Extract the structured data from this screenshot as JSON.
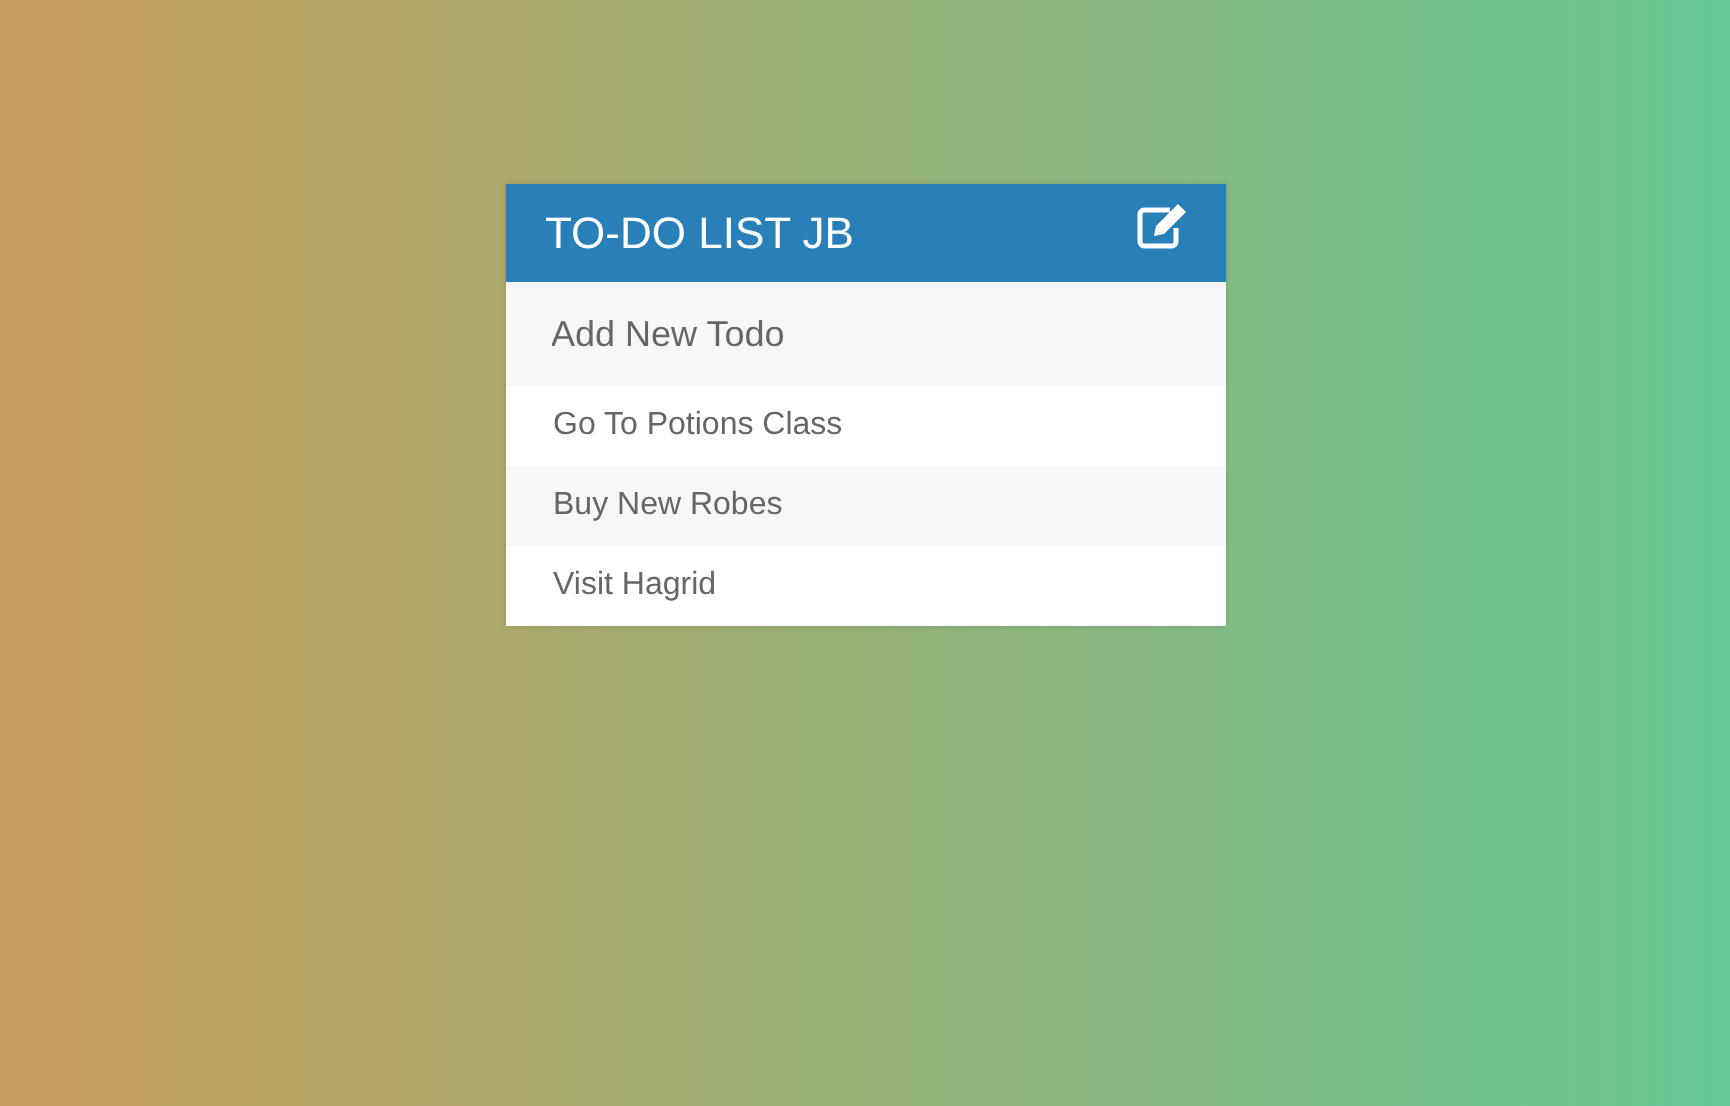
{
  "card": {
    "title": "TO-DO LIST JB"
  },
  "new_todo": {
    "placeholder": "Add New Todo"
  },
  "todos": [
    {
      "text": "Go To Potions Class"
    },
    {
      "text": "Buy New Robes"
    },
    {
      "text": "Visit Hagrid"
    }
  ]
}
